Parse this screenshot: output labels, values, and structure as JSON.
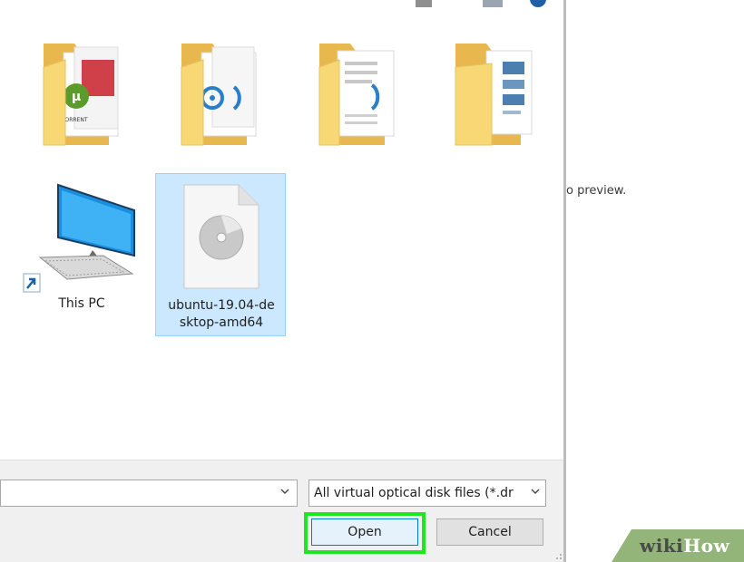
{
  "items": [
    {
      "name": "folder",
      "label": ""
    },
    {
      "name": "folder",
      "label": ""
    },
    {
      "name": "folder",
      "label": ""
    },
    {
      "name": "folder",
      "label": ""
    },
    {
      "name": "this-pc",
      "label": "This PC"
    },
    {
      "name": "iso-file",
      "label_line1": "ubuntu-19.04-de",
      "label_line2": "sktop-amd64",
      "selected": true
    }
  ],
  "preview": {
    "text": "o preview."
  },
  "footer": {
    "filename_value": "",
    "filter_selected": "All virtual optical disk files (*.dr",
    "open_label": "Open",
    "cancel_label": "Cancel"
  },
  "watermark": {
    "wiki": "wiki",
    "how": "How"
  },
  "colors": {
    "selection": "#cce8ff",
    "highlight": "#1fe622",
    "folder": "#f8d775",
    "accent": "#0078d7"
  }
}
